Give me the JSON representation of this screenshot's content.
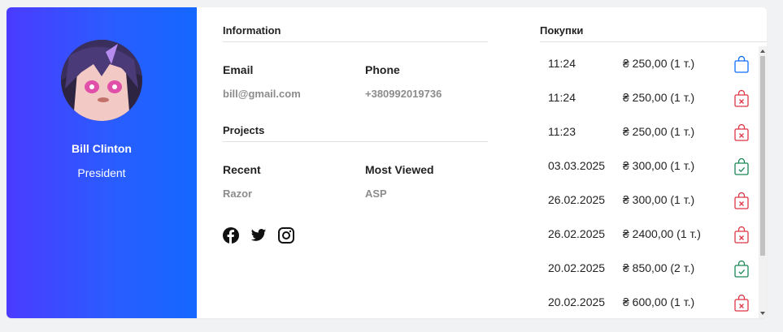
{
  "profile": {
    "name": "Bill Clinton",
    "role": "President"
  },
  "info": {
    "title": "Information",
    "email_label": "Email",
    "email_value": "bill@gmail.com",
    "phone_label": "Phone",
    "phone_value": "+380992019736"
  },
  "projects": {
    "title": "Projects",
    "recent_label": "Recent",
    "recent_value": "Razor",
    "viewed_label": "Most Viewed",
    "viewed_value": "ASP"
  },
  "social": [
    "facebook-icon",
    "twitter-icon",
    "instagram-icon"
  ],
  "purchases": {
    "title": "Покупки",
    "items": [
      {
        "time": "11:24",
        "price": "₴ 250,00 (1 т.)",
        "status": "pending",
        "color": "#0d6efd"
      },
      {
        "time": "11:24",
        "price": "₴ 250,00 (1 т.)",
        "status": "cancelled",
        "color": "#dc3545"
      },
      {
        "time": "11:23",
        "price": "₴ 250,00 (1 т.)",
        "status": "cancelled",
        "color": "#dc3545"
      },
      {
        "time": "03.03.2025",
        "price": "₴ 300,00 (1 т.)",
        "status": "completed",
        "color": "#198754"
      },
      {
        "time": "26.02.2025",
        "price": "₴ 300,00 (1 т.)",
        "status": "cancelled",
        "color": "#dc3545"
      },
      {
        "time": "26.02.2025",
        "price": "₴ 2400,00 (1 т.)",
        "status": "cancelled",
        "color": "#dc3545"
      },
      {
        "time": "20.02.2025",
        "price": "₴ 850,00 (2 т.)",
        "status": "completed",
        "color": "#198754"
      },
      {
        "time": "20.02.2025",
        "price": "₴ 600,00 (1 т.)",
        "status": "cancelled",
        "color": "#dc3545"
      }
    ]
  }
}
